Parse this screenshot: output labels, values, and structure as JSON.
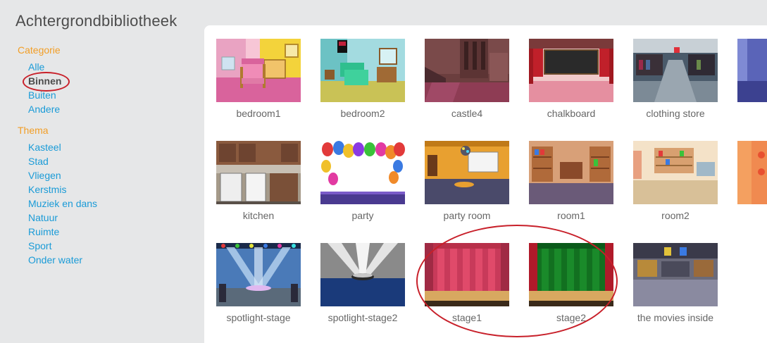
{
  "header": {
    "title": "Achtergrondbibliotheek"
  },
  "sidebar": {
    "category_heading": "Categorie",
    "categories": [
      "Alle",
      "Binnen",
      "Buiten",
      "Andere"
    ],
    "selected_category": "Binnen",
    "theme_heading": "Thema",
    "themes": [
      "Kasteel",
      "Stad",
      "Vliegen",
      "Kerstmis",
      "Muziek en dans",
      "Natuur",
      "Ruimte",
      "Sport",
      "Onder water"
    ]
  },
  "library": {
    "backdrops": [
      "bedroom1",
      "bedroom2",
      "castle4",
      "chalkboard",
      "clothing store",
      "kitchen",
      "party",
      "party room",
      "room1",
      "room2",
      "spotlight-stage",
      "spotlight-stage2",
      "stage1",
      "stage2",
      "the movies inside"
    ]
  },
  "colors": {
    "accent": "#f29e26",
    "link": "#1a9bd7",
    "annotation": "#c8202a"
  }
}
